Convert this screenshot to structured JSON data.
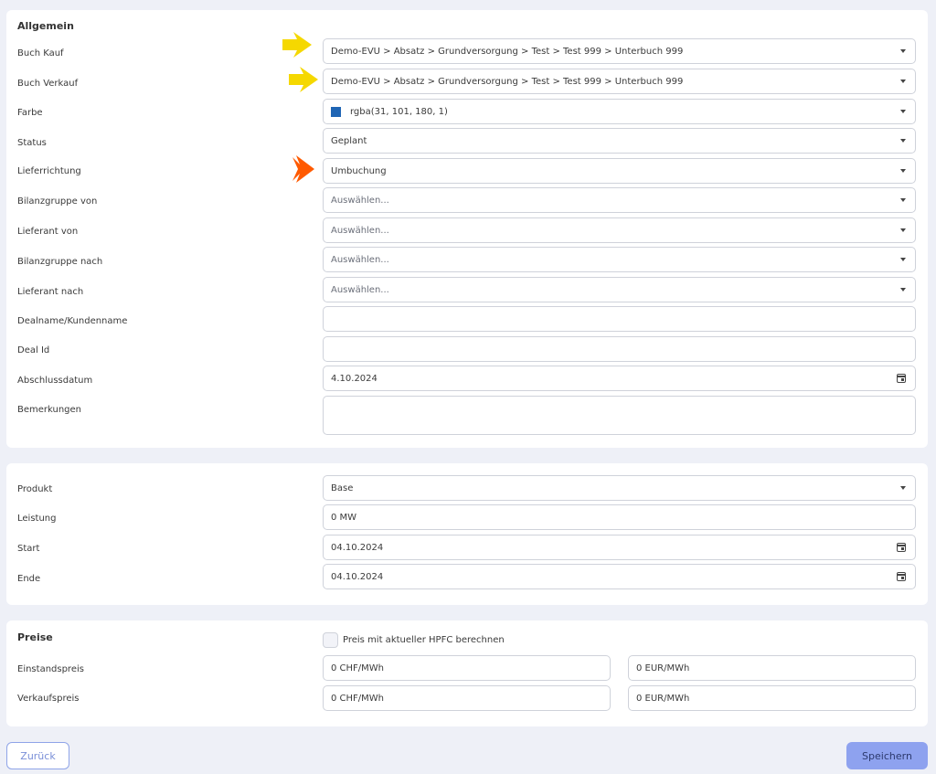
{
  "general": {
    "title": "Allgemein",
    "rows": [
      {
        "label": "Buch Kauf",
        "value": "Demo-EVU > Absatz > Grundversorgung > Test > Test 999 > Unterbuch 999"
      },
      {
        "label": "Buch Verkauf",
        "value": "Demo-EVU > Absatz > Grundversorgung > Test > Test 999 > Unterbuch 999"
      },
      {
        "label": "Farbe",
        "value": "rgba(31, 101, 180, 1)",
        "swatch_color": "#1f65b4"
      },
      {
        "label": "Status",
        "value": "Geplant"
      },
      {
        "label": "Lieferrichtung",
        "value": "Umbuchung"
      },
      {
        "label": "Bilanzgruppe von",
        "value": "Auswählen..."
      },
      {
        "label": "Lieferant von",
        "value": "Auswählen..."
      },
      {
        "label": "Bilanzgruppe nach",
        "value": "Auswählen..."
      },
      {
        "label": "Lieferant nach",
        "value": "Auswählen..."
      },
      {
        "label": "Dealname/Kundenname",
        "value": ""
      },
      {
        "label": "Deal Id",
        "value": ""
      },
      {
        "label": "Abschlussdatum",
        "value": "4.10.2024"
      },
      {
        "label": "Bemerkungen",
        "value": ""
      }
    ]
  },
  "product": {
    "rows": [
      {
        "label": "Produkt",
        "value": "Base"
      },
      {
        "label": "Leistung",
        "value": "0 MW"
      },
      {
        "label": "Start",
        "value": "04.10.2024"
      },
      {
        "label": "Ende",
        "value": "04.10.2024"
      }
    ]
  },
  "prices": {
    "title": "Preise",
    "checkbox_label": "Preis mit aktueller HPFC berechnen",
    "rows": [
      {
        "label": "Einstandspreis",
        "chf": "0 CHF/MWh",
        "eur": "0 EUR/MWh"
      },
      {
        "label": "Verkaufspreis",
        "chf": "0 CHF/MWh",
        "eur": "0 EUR/MWh"
      }
    ]
  },
  "buttons": {
    "back": "Zurück",
    "save": "Speichern"
  },
  "icons": {
    "dropdown": "chevron-down-icon",
    "calendar": "calendar-icon",
    "marker_yellow": "arrow-right-icon",
    "marker_orange": "arrow-right-icon"
  },
  "colors": {
    "marker_yellow": "#f5d800",
    "marker_orange": "#ff5a00",
    "accent": "#8ea2ef"
  }
}
